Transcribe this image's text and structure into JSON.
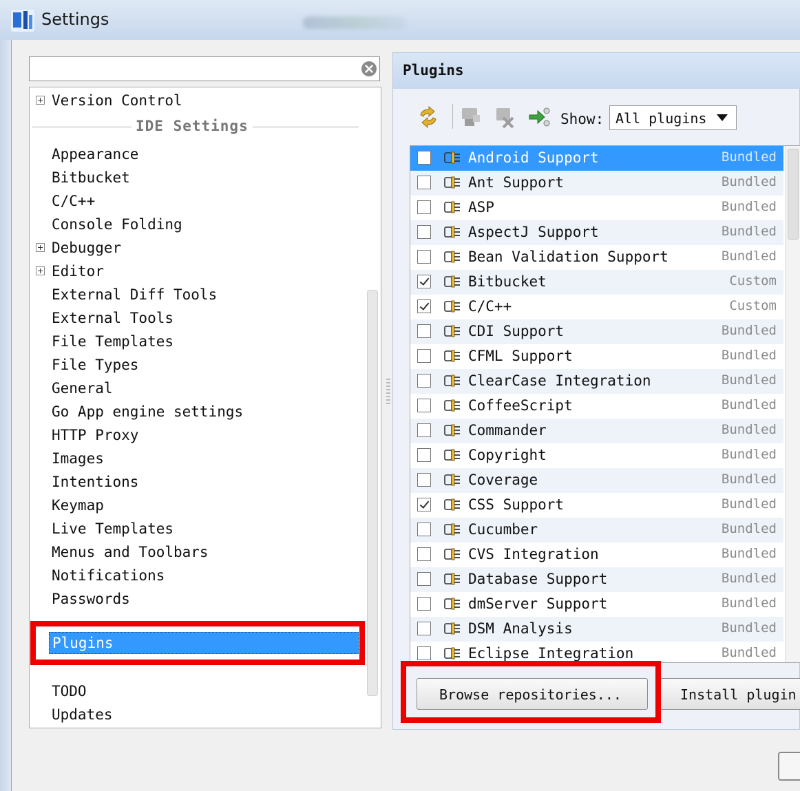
{
  "window": {
    "title": "Settings"
  },
  "sidebar": {
    "search_value": "",
    "version_control": "Version Control",
    "section_label": "IDE Settings",
    "items": [
      {
        "label": "Appearance",
        "expandable": false
      },
      {
        "label": "Bitbucket",
        "expandable": false
      },
      {
        "label": "C/C++",
        "expandable": false
      },
      {
        "label": "Console Folding",
        "expandable": false
      },
      {
        "label": "Debugger",
        "expandable": true
      },
      {
        "label": "Editor",
        "expandable": true
      },
      {
        "label": "External Diff Tools",
        "expandable": false
      },
      {
        "label": "External Tools",
        "expandable": false
      },
      {
        "label": "File Templates",
        "expandable": false
      },
      {
        "label": "File Types",
        "expandable": false
      },
      {
        "label": "General",
        "expandable": false
      },
      {
        "label": "Go App engine settings",
        "expandable": false
      },
      {
        "label": "HTTP Proxy",
        "expandable": false
      },
      {
        "label": "Images",
        "expandable": false
      },
      {
        "label": "Intentions",
        "expandable": false
      },
      {
        "label": "Keymap",
        "expandable": false
      },
      {
        "label": "Live Templates",
        "expandable": false
      },
      {
        "label": "Menus and Toolbars",
        "expandable": false
      },
      {
        "label": "Notifications",
        "expandable": false
      },
      {
        "label": "Passwords",
        "expandable": false
      }
    ],
    "selected": "Plugins",
    "after_items": [
      "TODO",
      "Updates"
    ]
  },
  "plugins": {
    "title": "Plugins",
    "show_label": "Show:",
    "show_value": "All plugins",
    "rows": [
      {
        "name": "Android Support",
        "type": "Bundled",
        "checked": false,
        "selected": true
      },
      {
        "name": "Ant Support",
        "type": "Bundled",
        "checked": false
      },
      {
        "name": "ASP",
        "type": "Bundled",
        "checked": false
      },
      {
        "name": "AspectJ Support",
        "type": "Bundled",
        "checked": false
      },
      {
        "name": "Bean Validation Support",
        "type": "Bundled",
        "checked": false
      },
      {
        "name": "Bitbucket",
        "type": "Custom",
        "checked": true
      },
      {
        "name": "C/C++",
        "type": "Custom",
        "checked": true
      },
      {
        "name": "CDI Support",
        "type": "Bundled",
        "checked": false
      },
      {
        "name": "CFML Support",
        "type": "Bundled",
        "checked": false
      },
      {
        "name": "ClearCase Integration",
        "type": "Bundled",
        "checked": false
      },
      {
        "name": "CoffeeScript",
        "type": "Bundled",
        "checked": false
      },
      {
        "name": "Commander",
        "type": "Bundled",
        "checked": false
      },
      {
        "name": "Copyright",
        "type": "Bundled",
        "checked": false
      },
      {
        "name": "Coverage",
        "type": "Bundled",
        "checked": false
      },
      {
        "name": "CSS Support",
        "type": "Bundled",
        "checked": true
      },
      {
        "name": "Cucumber",
        "type": "Bundled",
        "checked": false
      },
      {
        "name": "CVS Integration",
        "type": "Bundled",
        "checked": false
      },
      {
        "name": "Database Support",
        "type": "Bundled",
        "checked": false
      },
      {
        "name": "dmServer Support",
        "type": "Bundled",
        "checked": false
      },
      {
        "name": "DSM Analysis",
        "type": "Bundled",
        "checked": false
      },
      {
        "name": "Eclipse Integration",
        "type": "Bundled",
        "checked": false
      }
    ],
    "browse_button": "Browse repositories...",
    "install_button": "Install plugin"
  },
  "colors": {
    "selection": "#3399ff",
    "highlight": "#ee0000",
    "header": "#c7d9ef"
  }
}
